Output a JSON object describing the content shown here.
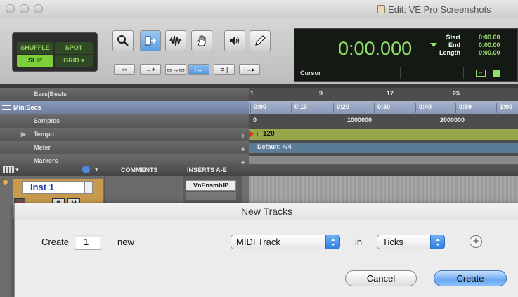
{
  "window": {
    "title": "Edit: VE Pro Screenshots"
  },
  "edit_modes": {
    "shuffle": "SHUFFLE",
    "spot": "SPOT",
    "slip": "SLIP",
    "grid": "GRID"
  },
  "tools": [
    "zoom-tool",
    "trim-tool",
    "selector-tool",
    "grabber-tool",
    "scrubber-tool",
    "pencil-tool"
  ],
  "counter": {
    "main_time": "0:00.000",
    "labels": {
      "start": "Start",
      "end": "End",
      "length": "Length"
    },
    "values": {
      "start": "0:00.00",
      "end": "0:00.00",
      "length": "0:00.00"
    },
    "cursor_label": "Cursor"
  },
  "rulers": {
    "bars_beats": {
      "label": "Bars|Beats",
      "ticks": [
        "1",
        "9",
        "17",
        "25"
      ]
    },
    "min_secs": {
      "label": "Min:Secs",
      "ticks": [
        "0:00",
        "0:10",
        "0:20",
        "0:30",
        "0:40",
        "0:50",
        "1:00"
      ]
    },
    "samples": {
      "label": "Samples",
      "ticks": [
        "0",
        "1000000",
        "2000000"
      ]
    },
    "tempo": {
      "label": "Tempo",
      "value": "120"
    },
    "meter": {
      "label": "Meter",
      "value": "Default: 4/4"
    },
    "markers": {
      "label": "Markers"
    }
  },
  "track_header": {
    "comments": "COMMENTS",
    "inserts": "INSERTS A-E"
  },
  "track": {
    "name": "Inst 1",
    "solo": "S",
    "mute": "M",
    "insert1": "VnEnsmblP"
  },
  "dialog": {
    "title": "New Tracks",
    "create_label": "Create",
    "count": "1",
    "new_label": "new",
    "track_type": "MIDI Track",
    "in_label": "in",
    "timebase": "Ticks",
    "cancel": "Cancel",
    "create_button": "Create"
  },
  "colors": {
    "counter_green": "#8fe06a",
    "selected_ruler": "#8797b6",
    "tempo_bar": "#96a84a",
    "meter_bar": "#5b7c97",
    "default_button": "#6aa8f0"
  }
}
